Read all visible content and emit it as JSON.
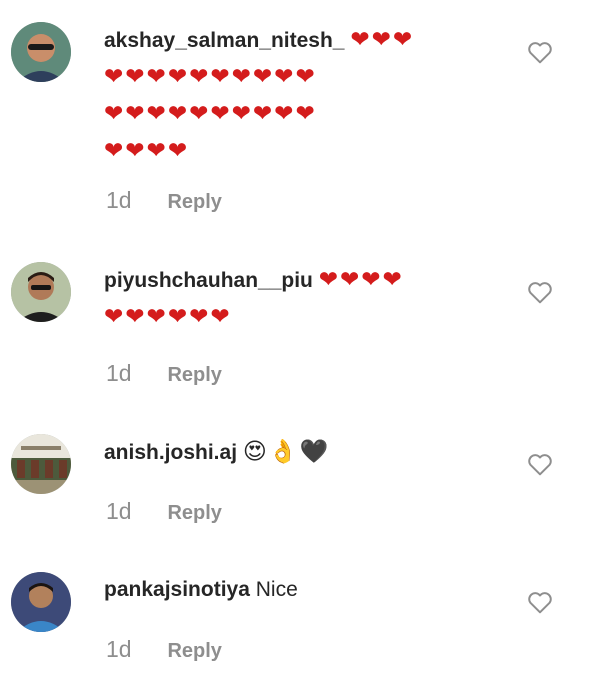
{
  "comments": [
    {
      "username": "akshay_salman_nitesh_",
      "text": "",
      "emoji_lines": [
        "❤❤❤",
        "❤❤❤❤❤❤❤❤❤❤",
        "❤❤❤❤❤❤❤❤❤❤",
        "❤❤❤❤"
      ],
      "time": "1d",
      "reply_label": "Reply"
    },
    {
      "username": "piyushchauhan__piu",
      "text": "",
      "emoji_lines": [
        "❤❤❤❤",
        "❤❤❤❤❤❤"
      ],
      "time": "1d",
      "reply_label": "Reply"
    },
    {
      "username": "anish.joshi.aj",
      "text": "",
      "emoji_lines": [
        "😍👌🖤"
      ],
      "time": "1d",
      "reply_label": "Reply"
    },
    {
      "username": "pankajsinotiya",
      "text": "Nice",
      "emoji_lines": [],
      "time": "1d",
      "reply_label": "Reply"
    }
  ],
  "icons": {
    "like": "heart-outline-icon",
    "avatar": "avatar"
  },
  "colors": {
    "text": "#262626",
    "muted": "#8e8e8e",
    "heart": "#d41c1c"
  }
}
